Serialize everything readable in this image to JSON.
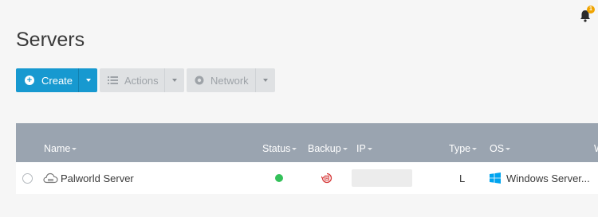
{
  "header": {
    "notification_count": "1"
  },
  "page": {
    "title": "Servers"
  },
  "toolbar": {
    "create_label": "Create",
    "actions_label": "Actions",
    "network_label": "Network"
  },
  "table": {
    "columns": [
      "Name",
      "Status",
      "Backup",
      "IP",
      "Type",
      "OS",
      "W"
    ],
    "rows": [
      {
        "name": "Palworld Server",
        "status": "running",
        "backup": "backup-icon",
        "ip": "",
        "type": "L",
        "os": "Windows Server..."
      }
    ]
  },
  "colors": {
    "primary": "#1799d0",
    "header_bg": "#9aa4b0",
    "status_ok": "#34c15a",
    "backup_red": "#d63a3a",
    "windows_blue": "#00a4ef",
    "badge": "#f0a400"
  }
}
